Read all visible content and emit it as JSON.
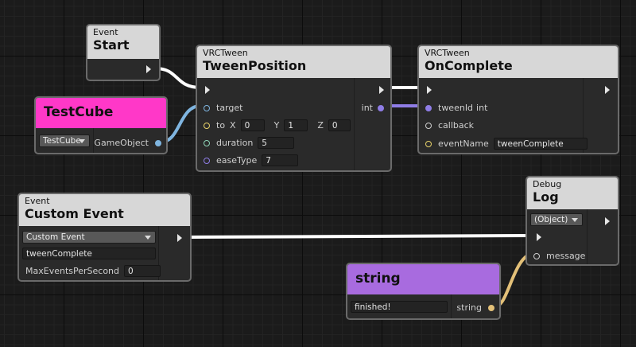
{
  "nodes": {
    "start": {
      "category": "Event",
      "title": "Start"
    },
    "tween_position": {
      "category": "VRCTween",
      "title": "TweenPosition",
      "target_label": "target",
      "to_label": "to",
      "x_label": "X",
      "x_value": "0",
      "y_label": "Y",
      "y_value": "1",
      "z_label": "Z",
      "z_value": "0",
      "duration_label": "duration",
      "duration_value": "5",
      "ease_label": "easeType",
      "ease_value": "7",
      "out_label": "int"
    },
    "on_complete": {
      "category": "VRCTween",
      "title": "OnComplete",
      "tween_id_label": "tweenId",
      "tween_id_type": "int",
      "callback_label": "callback",
      "event_name_label": "eventName",
      "event_name_value": "tweenComplete"
    },
    "test_cube": {
      "title": "TestCube",
      "dropdown": "TestCube",
      "out_label": "GameObject",
      "color": "#ff38c8"
    },
    "custom_event": {
      "category": "Event",
      "title": "Custom Event",
      "dropdown": "Custom Event",
      "name_value": "tweenComplete",
      "max_label": "MaxEventsPerSecond",
      "max_value": "0"
    },
    "debug_log": {
      "category": "Debug",
      "title": "Log",
      "dropdown": "(Object)",
      "message_label": "message"
    },
    "string_node": {
      "title": "string",
      "value": "finished!",
      "out_label": "string",
      "color": "#a86bdf"
    }
  },
  "colors": {
    "flow_wire": "#ffffff",
    "gameobject_wire": "#7fb5e0",
    "int_wire": "#8f7de6",
    "string_wire": "#e3c078"
  }
}
